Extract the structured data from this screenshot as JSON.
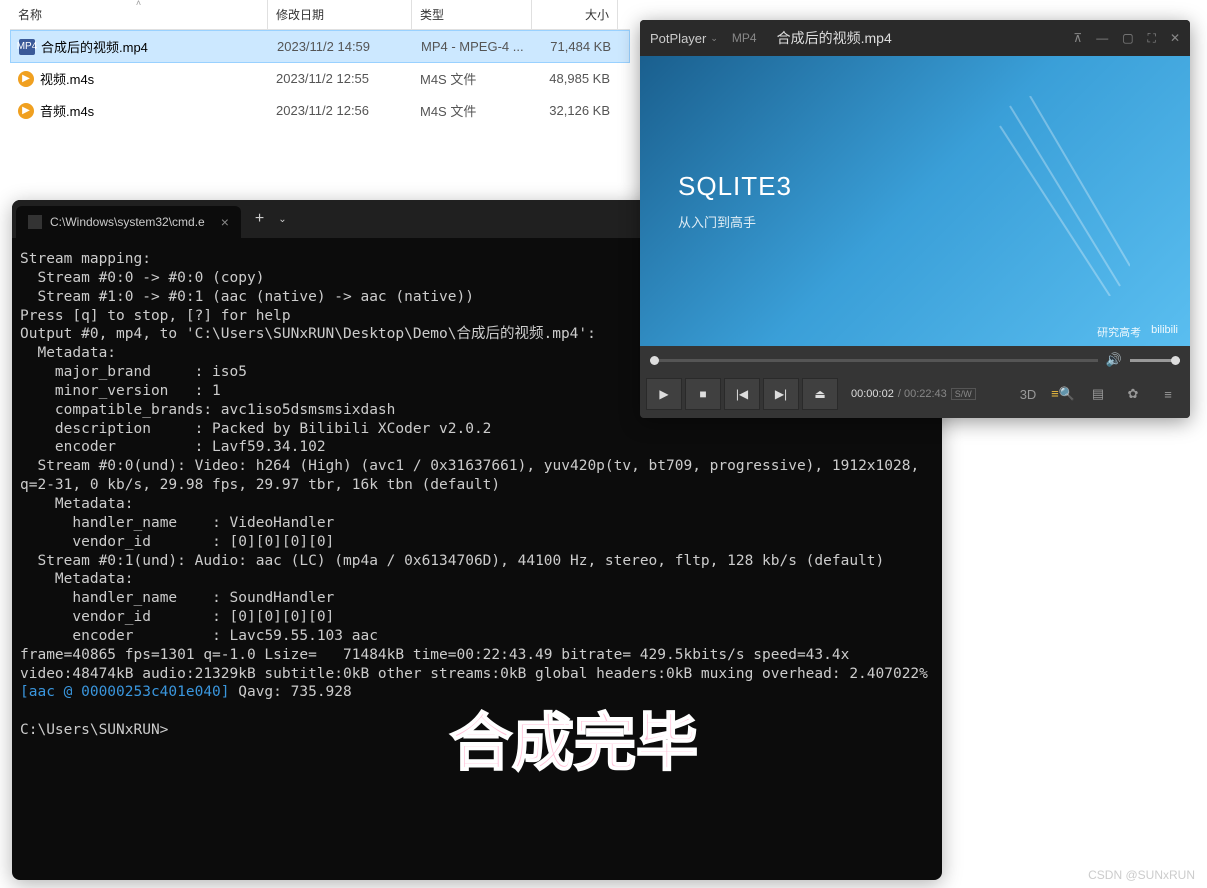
{
  "explorer": {
    "headers": {
      "name": "名称",
      "date": "修改日期",
      "type": "类型",
      "size": "大小"
    },
    "files": [
      {
        "icon": "mp4",
        "name": "合成后的视频.mp4",
        "date": "2023/11/2 14:59",
        "type": "MP4 - MPEG-4 ...",
        "size": "71,484 KB",
        "selected": true
      },
      {
        "icon": "m4s",
        "name": "视频.m4s",
        "date": "2023/11/2 12:55",
        "type": "M4S 文件",
        "size": "48,985 KB",
        "selected": false
      },
      {
        "icon": "m4s",
        "name": "音频.m4s",
        "date": "2023/11/2 12:56",
        "type": "M4S 文件",
        "size": "32,126 KB",
        "selected": false
      }
    ]
  },
  "terminal": {
    "tab_title": "C:\\Windows\\system32\\cmd.e",
    "lines_plain": "Stream mapping:\n  Stream #0:0 -> #0:0 (copy)\n  Stream #1:0 -> #0:1 (aac (native) -> aac (native))\nPress [q] to stop, [?] for help\nOutput #0, mp4, to 'C:\\Users\\SUNxRUN\\Desktop\\Demo\\合成后的视频.mp4':\n  Metadata:\n    major_brand     : iso5\n    minor_version   : 1\n    compatible_brands: avc1iso5dsmsmsixdash\n    description     : Packed by Bilibili XCoder v2.0.2\n    encoder         : Lavf59.34.102\n  Stream #0:0(und): Video: h264 (High) (avc1 / 0x31637661), yuv420p(tv, bt709, progressive), 1912x1028, q=2-31, 0 kb/s, 29.98 fps, 29.97 tbr, 16k tbn (default)\n    Metadata:\n      handler_name    : VideoHandler\n      vendor_id       : [0][0][0][0]\n  Stream #0:1(und): Audio: aac (LC) (mp4a / 0x6134706D), 44100 Hz, stereo, fltp, 128 kb/s (default)\n    Metadata:\n      handler_name    : SoundHandler\n      vendor_id       : [0][0][0][0]\n      encoder         : Lavc59.55.103 aac\nframe=40865 fps=1301 q=-1.0 Lsize=   71484kB time=00:22:43.49 bitrate= 429.5kbits/s speed=43.4x\nvideo:48474kB audio:21329kB subtitle:0kB other streams:0kB global headers:0kB muxing overhead: 2.407022%",
    "aac_tag": "[aac @ 00000253c401e040]",
    "aac_rest": " Qavg: 735.928",
    "prompt": "C:\\Users\\SUNxRUN>"
  },
  "overlay": "合成完毕",
  "player": {
    "app_name": "PotPlayer",
    "format": "MP4",
    "filename": "合成后的视频.mp4",
    "video": {
      "title": "SQLITE3",
      "subtitle": "从入门到高手",
      "credit": "研究高考",
      "brand": "bilibili"
    },
    "time": {
      "current": "00:00:02",
      "total": "00:22:43",
      "mode": "S/W"
    },
    "buttons": {
      "d3": "3D"
    }
  },
  "watermark": "CSDN @SUNxRUN"
}
